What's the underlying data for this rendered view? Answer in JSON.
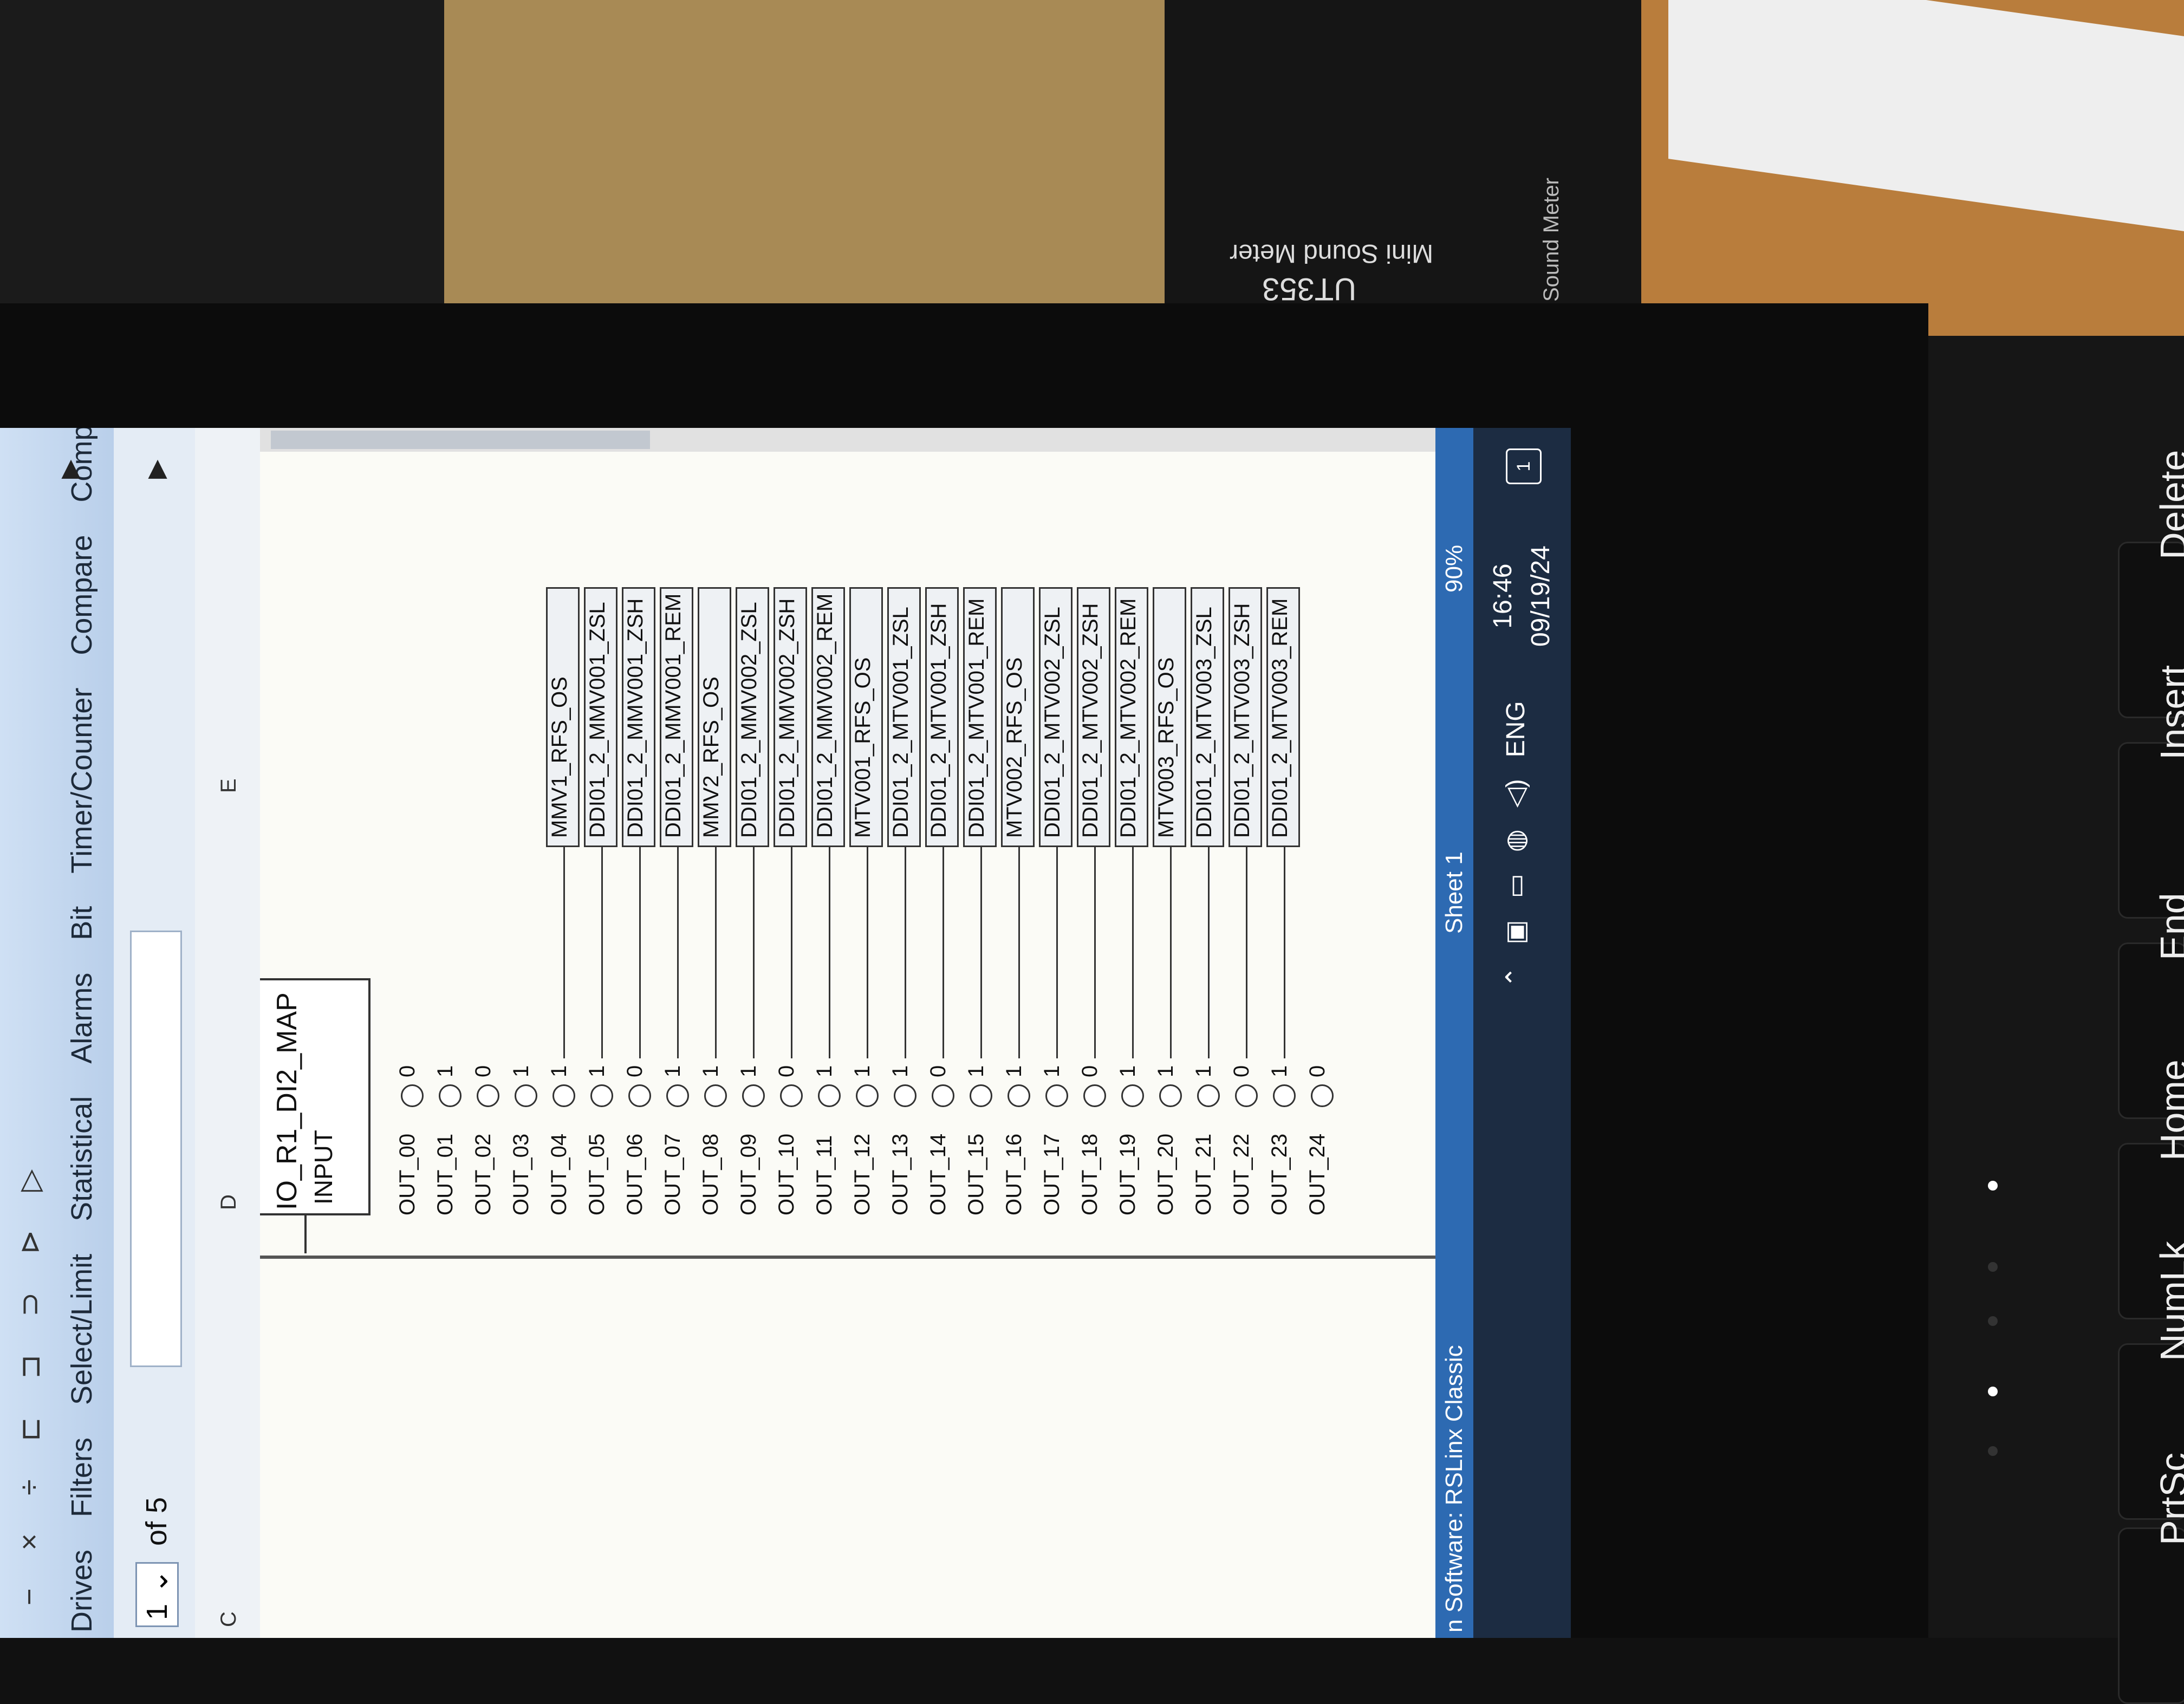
{
  "toolbar": {
    "icons": [
      "minus-icon",
      "times-icon",
      "divide-icon",
      "gate-icon-1",
      "gate-icon-2",
      "gate-icon-3",
      "gate-icon-4",
      "arrow-icon"
    ],
    "tabs": [
      "Drives",
      "Filters",
      "Select/Limit",
      "Statistical",
      "Alarms",
      "Bit",
      "Timer/Counter",
      "Compare",
      "Compute/Ma"
    ]
  },
  "nav": {
    "page_value": "1",
    "page_of": "of 5"
  },
  "grid": {
    "columns": [
      "C",
      "D",
      "E"
    ]
  },
  "instruction": {
    "name": "IO_R1_DI2_MAP",
    "input_label": "INPUT"
  },
  "io_rows": [
    {
      "pin": "OUT_00",
      "value": "0",
      "tag": ""
    },
    {
      "pin": "OUT_01",
      "value": "1",
      "tag": ""
    },
    {
      "pin": "OUT_02",
      "value": "0",
      "tag": ""
    },
    {
      "pin": "OUT_03",
      "value": "1",
      "tag": ""
    },
    {
      "pin": "OUT_04",
      "value": "1",
      "tag": "MMV1_RFS_OS"
    },
    {
      "pin": "OUT_05",
      "value": "1",
      "tag": "DDI01_2_MMV001_ZSL"
    },
    {
      "pin": "OUT_06",
      "value": "0",
      "tag": "DDI01_2_MMV001_ZSH"
    },
    {
      "pin": "OUT_07",
      "value": "1",
      "tag": "DDI01_2_MMV001_REM"
    },
    {
      "pin": "OUT_08",
      "value": "1",
      "tag": "MMV2_RFS_OS"
    },
    {
      "pin": "OUT_09",
      "value": "1",
      "tag": "DDI01_2_MMV002_ZSL"
    },
    {
      "pin": "OUT_10",
      "value": "0",
      "tag": "DDI01_2_MMV002_ZSH"
    },
    {
      "pin": "OUT_11",
      "value": "1",
      "tag": "DDI01_2_MMV002_REM"
    },
    {
      "pin": "OUT_12",
      "value": "1",
      "tag": "MTV001_RFS_OS"
    },
    {
      "pin": "OUT_13",
      "value": "1",
      "tag": "DDI01_2_MTV001_ZSL"
    },
    {
      "pin": "OUT_14",
      "value": "0",
      "tag": "DDI01_2_MTV001_ZSH"
    },
    {
      "pin": "OUT_15",
      "value": "1",
      "tag": "DDI01_2_MTV001_REM"
    },
    {
      "pin": "OUT_16",
      "value": "1",
      "tag": "MTV002_RFS_OS"
    },
    {
      "pin": "OUT_17",
      "value": "1",
      "tag": "DDI01_2_MTV002_ZSL"
    },
    {
      "pin": "OUT_18",
      "value": "0",
      "tag": "DDI01_2_MTV002_ZSH"
    },
    {
      "pin": "OUT_19",
      "value": "1",
      "tag": "DDI01_2_MTV002_REM"
    },
    {
      "pin": "OUT_20",
      "value": "1",
      "tag": "MTV003_RFS_OS"
    },
    {
      "pin": "OUT_21",
      "value": "1",
      "tag": "DDI01_2_MTV003_ZSL"
    },
    {
      "pin": "OUT_22",
      "value": "0",
      "tag": "DDI01_2_MTV003_ZSH"
    },
    {
      "pin": "OUT_23",
      "value": "1",
      "tag": "DDI01_2_MTV003_REM"
    },
    {
      "pin": "OUT_24",
      "value": "0",
      "tag": ""
    }
  ],
  "status": {
    "left": "n Software: RSLinx Classic",
    "sheet": "Sheet 1",
    "zoom": "90%"
  },
  "taskbar": {
    "lang": "ENG",
    "time": "16:46",
    "date": "09/19/24"
  },
  "surroundings": {
    "meter_name": "Mini Sound Meter",
    "meter_model": "UT353",
    "meter_side": "Sound Meter",
    "keys": [
      "Delete",
      "Insert",
      "End",
      "Home",
      "NumLk",
      "PrtSc"
    ]
  }
}
